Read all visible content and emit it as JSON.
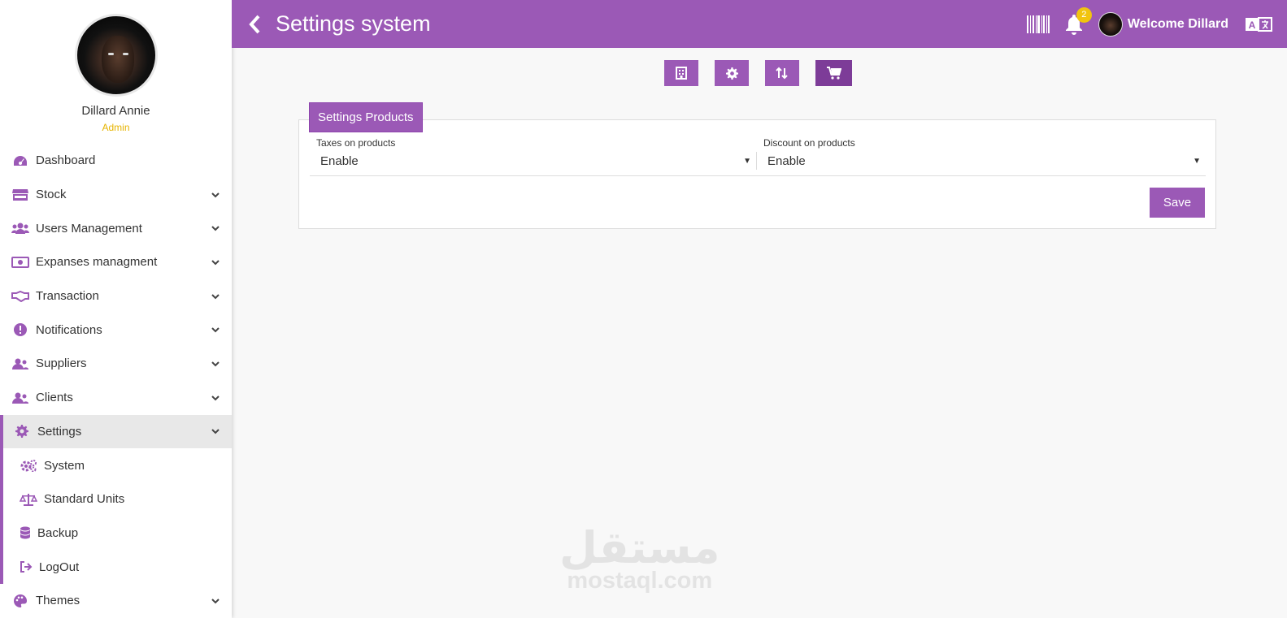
{
  "profile": {
    "name": "Dillard Annie",
    "role": "Admin"
  },
  "sidebar": {
    "items": [
      {
        "label": "Dashboard",
        "icon": "dashboard-icon"
      },
      {
        "label": "Stock",
        "icon": "store-icon"
      },
      {
        "label": "Users Management",
        "icon": "users-icon"
      },
      {
        "label": "Expanses managment",
        "icon": "money-icon"
      },
      {
        "label": "Transaction",
        "icon": "handshake-icon"
      },
      {
        "label": "Notifications",
        "icon": "exclamation-icon"
      },
      {
        "label": "Suppliers",
        "icon": "users-icon"
      },
      {
        "label": "Clients",
        "icon": "users-icon"
      },
      {
        "label": "Settings",
        "icon": "gear-icon"
      }
    ],
    "submenu": [
      {
        "label": "System",
        "icon": "gears-icon"
      },
      {
        "label": "Standard Units",
        "icon": "scale-icon"
      },
      {
        "label": "Backup",
        "icon": "database-icon"
      },
      {
        "label": "LogOut",
        "icon": "logout-icon"
      }
    ],
    "themes": {
      "label": "Themes",
      "icon": "palette-icon"
    }
  },
  "header": {
    "title": "Settings system",
    "notification_count": "2",
    "welcome": "Welcome Dillard"
  },
  "card": {
    "tab_label": "Settings Products",
    "taxes": {
      "label": "Taxes on products",
      "value": "Enable"
    },
    "discount": {
      "label": "Discount on products",
      "value": "Enable"
    },
    "save_label": "Save"
  },
  "watermark": {
    "arabic": "مستقل",
    "latin": "mostaql.com"
  },
  "colors": {
    "accent": "#9b59b6",
    "accent_dark": "#7d3c98",
    "badge": "#f1c40f",
    "role": "#e6b400"
  }
}
